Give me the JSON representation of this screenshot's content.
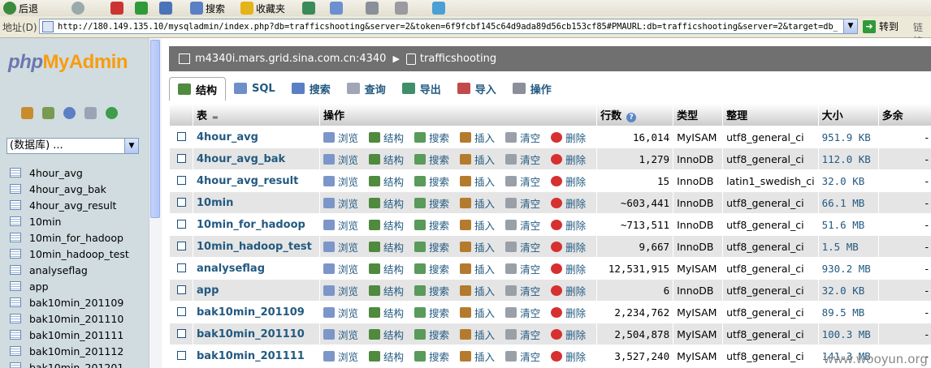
{
  "browser": {
    "toolbar": [
      {
        "icon": "back-icon",
        "label": "后退"
      },
      {
        "icon": "forward-icon",
        "label": ""
      },
      {
        "icon": "stop-icon",
        "label": ""
      },
      {
        "icon": "refresh-icon",
        "label": ""
      },
      {
        "icon": "home-icon",
        "label": ""
      },
      {
        "icon": "search-icon",
        "label": "搜索"
      },
      {
        "icon": "favorites-icon",
        "label": "收藏夹"
      },
      {
        "icon": "history-icon",
        "label": ""
      },
      {
        "icon": "mail-icon",
        "label": ""
      },
      {
        "icon": "print-icon",
        "label": ""
      },
      {
        "icon": "edit-icon",
        "label": ""
      },
      {
        "icon": "messenger-icon",
        "label": ""
      }
    ],
    "address_label": "地址(D)",
    "url": "http://180.149.135.10/mysqladmin/index.php?db=trafficshooting&server=2&token=6f9fcbf145c64d9ada89d56cb153cf85#PMAURL:db=trafficshooting&server=2&target=db_structu",
    "go_label": "转到",
    "links_label": "链接"
  },
  "left": {
    "logo_php": "php",
    "logo_myadmin": "MyAdmin",
    "db_select": "(数据库) ...",
    "tables": [
      "4hour_avg",
      "4hour_avg_bak",
      "4hour_avg_result",
      "10min",
      "10min_for_hadoop",
      "10min_hadoop_test",
      "analyseflag",
      "app",
      "bak10min_201109",
      "bak10min_201110",
      "bak10min_201111",
      "bak10min_201112",
      "bak10min_201201"
    ]
  },
  "breadcrumb": {
    "server": "m4340i.mars.grid.sina.com.cn:4340",
    "separator": "▶",
    "database": "trafficshooting"
  },
  "tabs": [
    {
      "label": "结构",
      "icon": "structure-icon",
      "active": true
    },
    {
      "label": "SQL",
      "icon": "sql-icon",
      "active": false
    },
    {
      "label": "搜索",
      "icon": "search-icon",
      "active": false
    },
    {
      "label": "查询",
      "icon": "query-icon",
      "active": false
    },
    {
      "label": "导出",
      "icon": "export-icon",
      "active": false
    },
    {
      "label": "导入",
      "icon": "import-icon",
      "active": false
    },
    {
      "label": "操作",
      "icon": "operations-icon",
      "active": false
    }
  ],
  "table": {
    "headers": {
      "table": "表",
      "actions": "操作",
      "rows": "行数",
      "type": "类型",
      "collation": "整理",
      "size": "大小",
      "overhead": "多余"
    },
    "action_labels": [
      "浏览",
      "结构",
      "搜索",
      "插入",
      "清空",
      "删除"
    ],
    "rows": [
      {
        "name": "4hour_avg",
        "rows": "16,014",
        "type": "MyISAM",
        "collation": "utf8_general_ci",
        "size": "951.9",
        "unit": "KB",
        "overhead": "-"
      },
      {
        "name": "4hour_avg_bak",
        "rows": "1,279",
        "type": "InnoDB",
        "collation": "utf8_general_ci",
        "size": "112.0",
        "unit": "KB",
        "overhead": "-"
      },
      {
        "name": "4hour_avg_result",
        "rows": "15",
        "type": "InnoDB",
        "collation": "latin1_swedish_ci",
        "size": "32.0",
        "unit": "KB",
        "overhead": "-"
      },
      {
        "name": "10min",
        "rows": "~603,441",
        "type": "InnoDB",
        "collation": "utf8_general_ci",
        "size": "66.1",
        "unit": "MB",
        "overhead": "-"
      },
      {
        "name": "10min_for_hadoop",
        "rows": "~713,511",
        "type": "InnoDB",
        "collation": "utf8_general_ci",
        "size": "51.6",
        "unit": "MB",
        "overhead": "-"
      },
      {
        "name": "10min_hadoop_test",
        "rows": "9,667",
        "type": "InnoDB",
        "collation": "utf8_general_ci",
        "size": "1.5",
        "unit": "MB",
        "overhead": "-"
      },
      {
        "name": "analyseflag",
        "rows": "12,531,915",
        "type": "MyISAM",
        "collation": "utf8_general_ci",
        "size": "930.2",
        "unit": "MB",
        "overhead": "-"
      },
      {
        "name": "app",
        "rows": "6",
        "type": "InnoDB",
        "collation": "utf8_general_ci",
        "size": "32.0",
        "unit": "KB",
        "overhead": "-"
      },
      {
        "name": "bak10min_201109",
        "rows": "2,234,762",
        "type": "MyISAM",
        "collation": "utf8_general_ci",
        "size": "89.5",
        "unit": "MB",
        "overhead": "-"
      },
      {
        "name": "bak10min_201110",
        "rows": "2,504,878",
        "type": "MyISAM",
        "collation": "utf8_general_ci",
        "size": "100.3",
        "unit": "MB",
        "overhead": "-"
      },
      {
        "name": "bak10min_201111",
        "rows": "3,527,240",
        "type": "MyISAM",
        "collation": "utf8_general_ci",
        "size": "141.3",
        "unit": "MB",
        "overhead": "-"
      }
    ]
  },
  "watermark": "www.wooyun.org",
  "colors": {
    "link": "#235a81",
    "logo_php": "#6c78af",
    "logo_myadmin": "#f89c0e",
    "server_bar": "#707070",
    "left_bg": "#d0dce0"
  }
}
